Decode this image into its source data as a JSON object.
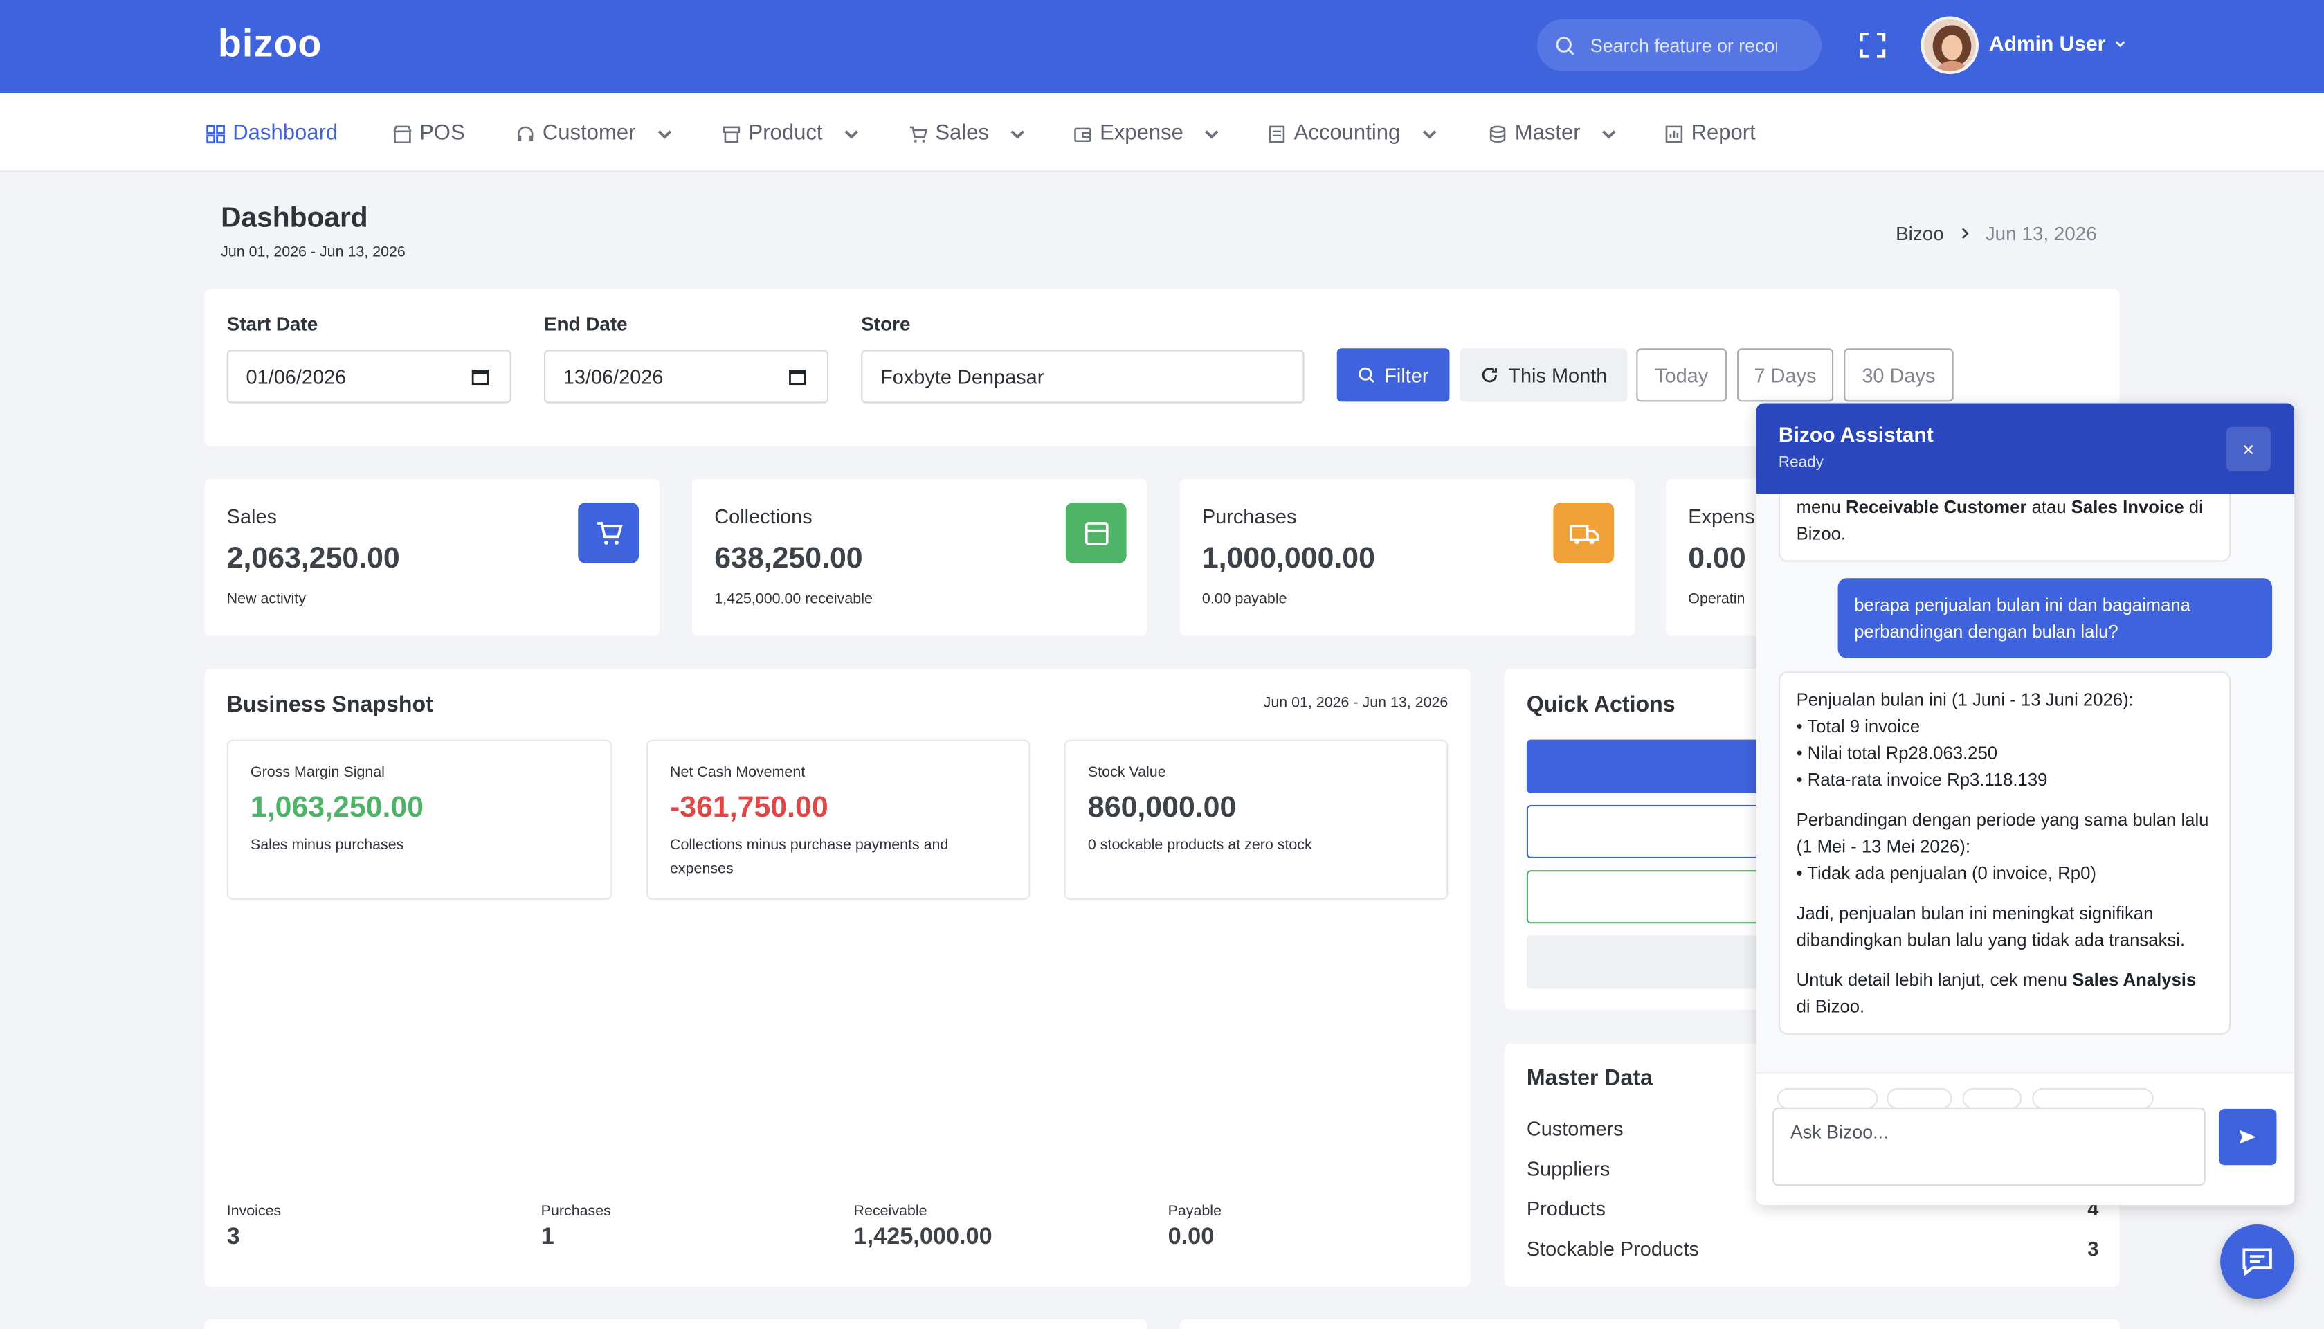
{
  "app": {
    "logo": "bizoo"
  },
  "topbar": {
    "search_placeholder": "Search feature or record",
    "user_name": "Admin User"
  },
  "nav": [
    {
      "label": "Dashboard",
      "icon": "grid-icon"
    },
    {
      "label": "POS",
      "icon": "store-icon"
    },
    {
      "label": "Customer",
      "icon": "headset-icon"
    },
    {
      "label": "Product",
      "icon": "box-icon"
    },
    {
      "label": "Sales",
      "icon": "cart-icon"
    },
    {
      "label": "Expense",
      "icon": "wallet-icon"
    },
    {
      "label": "Accounting",
      "icon": "ledger-icon"
    },
    {
      "label": "Master",
      "icon": "database-icon"
    },
    {
      "label": "Report",
      "icon": "chart-icon"
    }
  ],
  "page": {
    "title": "Dashboard",
    "subtitle": "Jun 01, 2026 - Jun 13, 2026",
    "breadcrumb_root": "Bizoo",
    "breadcrumb_current": "Jun 13, 2026"
  },
  "filters": {
    "start_label": "Start Date",
    "start_value": "01/06/2026",
    "end_label": "End Date",
    "end_value": "13/06/2026",
    "store_label": "Store",
    "store_value": "Foxbyte Denpasar",
    "filter_btn": "Filter",
    "this_month": "This Month",
    "today": "Today",
    "seven_days": "7 Days",
    "thirty_days": "30 Days"
  },
  "stats": [
    {
      "label": "Sales",
      "value": "2,063,250.00",
      "sub": "New activity",
      "icon": "cart-icon",
      "color": "#3f63dd"
    },
    {
      "label": "Collections",
      "value": "638,250.00",
      "sub": "1,425,000.00 receivable",
      "icon": "wallet-icon",
      "color": "#4fb468"
    },
    {
      "label": "Purchases",
      "value": "1,000,000.00",
      "sub": "0.00 payable",
      "icon": "truck-icon",
      "color": "#f0a137"
    },
    {
      "label": "Expens",
      "value": "0.00",
      "sub": "Operatin"
    }
  ],
  "snapshot": {
    "title": "Business Snapshot",
    "range": "Jun 01, 2026 - Jun 13, 2026",
    "boxes": [
      {
        "label": "Gross Margin Signal",
        "value": "1,063,250.00",
        "desc": "Sales minus purchases",
        "color": "#4fb468"
      },
      {
        "label": "Net Cash Movement",
        "value": "-361,750.00",
        "desc": "Collections minus purchase payments and expenses",
        "color": "#e04848"
      },
      {
        "label": "Stock Value",
        "value": "860,000.00",
        "desc": "0 stockable products at zero stock",
        "color": "#3d4148"
      }
    ],
    "mini": [
      {
        "label": "Invoices",
        "value": "3"
      },
      {
        "label": "Purchases",
        "value": "1"
      },
      {
        "label": "Receivable",
        "value": "1,425,000.00"
      },
      {
        "label": "Payable",
        "value": "0.00"
      }
    ]
  },
  "quick_actions": {
    "title": "Quick Actions",
    "btn1": "+"
  },
  "master": {
    "title": "Master Data",
    "rows": [
      {
        "label": "Customers",
        "value": ""
      },
      {
        "label": "Suppliers",
        "value": ""
      },
      {
        "label": "Products",
        "value": "4"
      },
      {
        "label": "Stockable Products",
        "value": "3"
      }
    ]
  },
  "assistant": {
    "title": "Bizoo Assistant",
    "status": "Ready",
    "close": "×",
    "msg0_pre": "menu ",
    "msg0_b1": "Receivable Customer",
    "msg0_mid": " atau ",
    "msg0_b2": "Sales Invoice",
    "msg0_post": " di Bizoo.",
    "user_msg": "berapa penjualan bulan ini dan bagaimana perbandingan dengan bulan lalu?",
    "r1": "Penjualan bulan ini (1 Juni - 13 Juni 2026):",
    "r2": "• Total 9 invoice",
    "r3": "• Nilai total Rp28.063.250",
    "r4": "• Rata-rata invoice Rp3.118.139",
    "r5": "Perbandingan dengan periode yang sama bulan lalu (1 Mei - 13 Mei 2026):",
    "r6": "• Tidak ada penjualan (0 invoice, Rp0)",
    "r7": "Jadi, penjualan bulan ini meningkat signifikan dibandingkan bulan lalu yang tidak ada transaksi.",
    "r8_pre": "Untuk detail lebih lanjut, cek menu ",
    "r8_b": "Sales Analysis",
    "r8_post": " di Bizoo.",
    "input_placeholder": "Ask Bizoo..."
  }
}
